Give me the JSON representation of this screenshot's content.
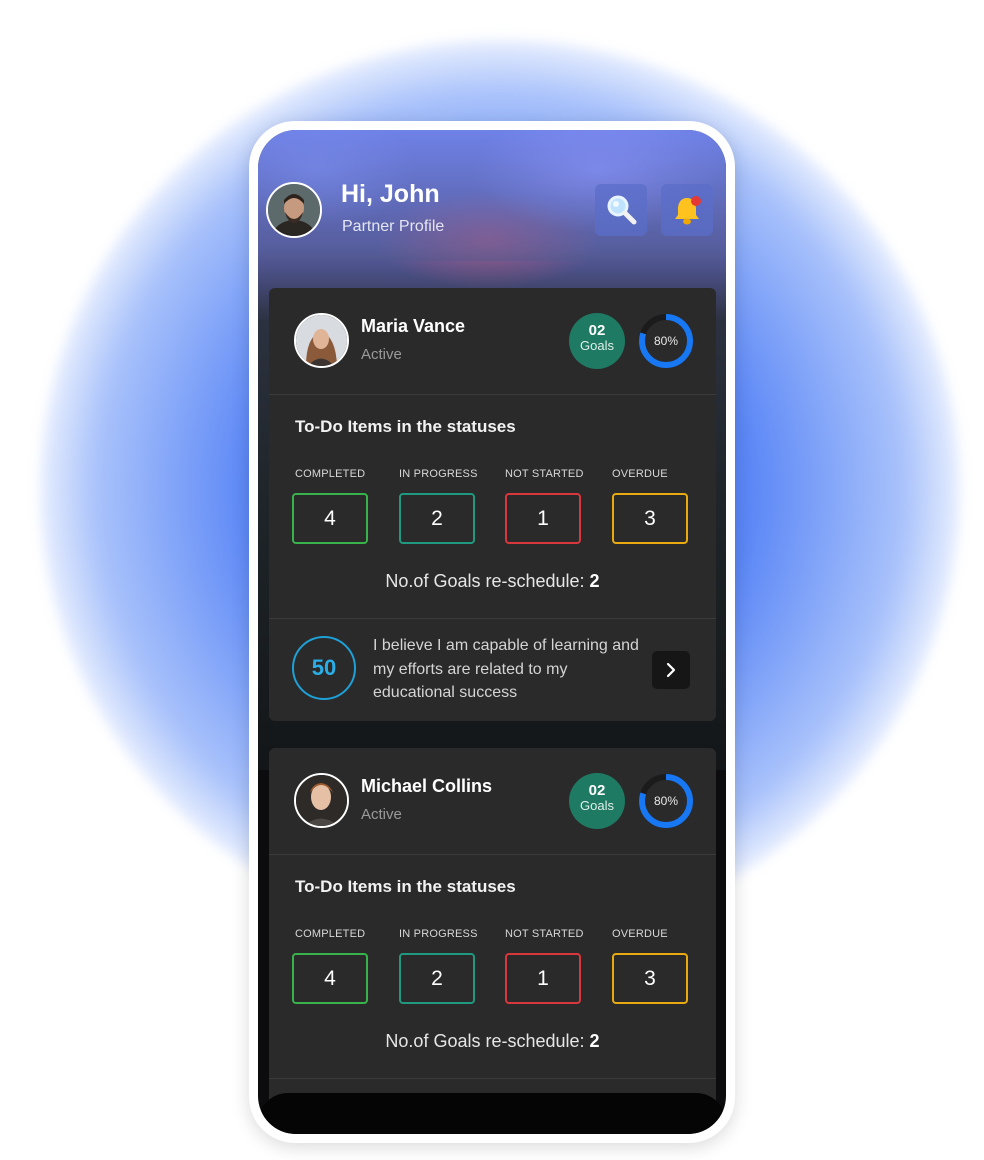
{
  "header": {
    "greeting": "Hi, John",
    "subtitle": "Partner Profile",
    "search_icon": "search-icon",
    "notification_icon": "bell-icon"
  },
  "statuses": {
    "title": "To-Do Items in the statuses",
    "labels": [
      "COMPLETED",
      "IN PROGRESS",
      "NOT STARTED",
      "OVERDUE"
    ],
    "colors": [
      "#38b24a",
      "#1f9a80",
      "#d8373d",
      "#e8aa10"
    ]
  },
  "reschedule_label": "No.of Goals re-schedule:",
  "partners": [
    {
      "name": "Maria Vance",
      "status": "Active",
      "goals_count": "02",
      "goals_label": "Goals",
      "progress_text": "80%",
      "progress": 0.8,
      "counts": [
        "4",
        "2",
        "1",
        "3"
      ],
      "reschedule_count": "2",
      "score": "50",
      "quote": "I believe I am capable of learning and my efforts are related to my educational success"
    },
    {
      "name": "Michael Collins",
      "status": "Active",
      "goals_count": "02",
      "goals_label": "Goals",
      "progress_text": "80%",
      "progress": 0.8,
      "counts": [
        "4",
        "2",
        "1",
        "3"
      ],
      "reschedule_count": "2"
    }
  ],
  "colors": {
    "accent": "#1877f2",
    "card_bg": "#2a2a2a",
    "goals_bg": "#1e7a62",
    "score": "#1ea0d6"
  }
}
